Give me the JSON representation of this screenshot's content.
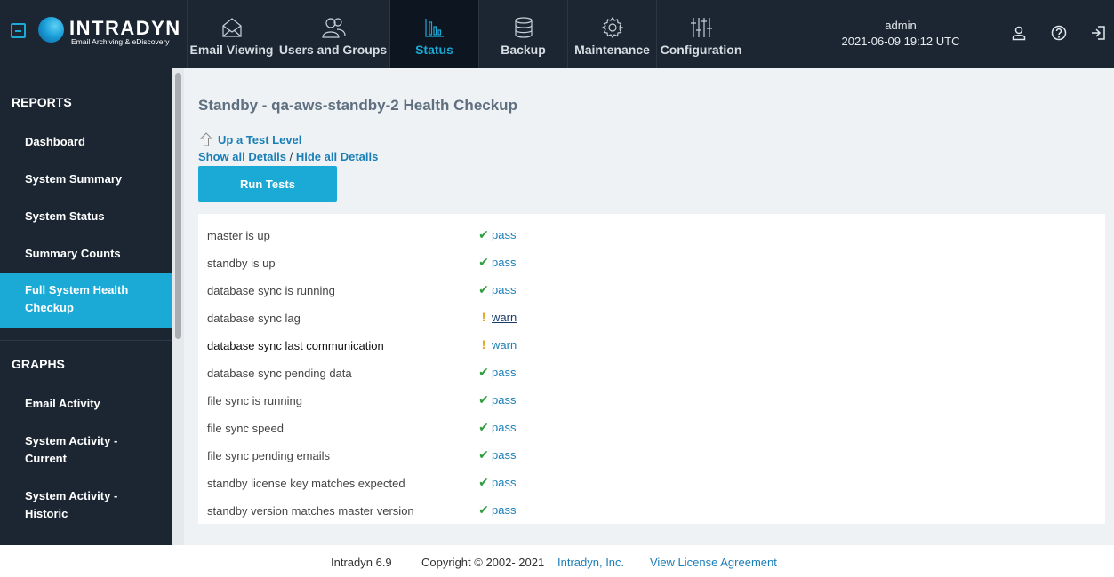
{
  "brand": {
    "name": "INTRADYN",
    "tagline": "Email Archiving & eDiscovery"
  },
  "nav": [
    {
      "label": "Email Viewing",
      "icon": "envelope-icon"
    },
    {
      "label": "Users and Groups",
      "icon": "users-icon"
    },
    {
      "label": "Status",
      "icon": "bar-chart-icon",
      "active": true
    },
    {
      "label": "Backup",
      "icon": "database-icon"
    },
    {
      "label": "Maintenance",
      "icon": "gear-icon"
    },
    {
      "label": "Configuration",
      "icon": "sliders-icon"
    }
  ],
  "user": {
    "name": "admin",
    "datetime": "2021-06-09 19:12 UTC"
  },
  "sidebar": {
    "reports_heading": "REPORTS",
    "reports": [
      {
        "label": "Dashboard"
      },
      {
        "label": "System Summary"
      },
      {
        "label": "System Status"
      },
      {
        "label": "Summary Counts"
      },
      {
        "label": "Full System Health Checkup",
        "active": true
      }
    ],
    "graphs_heading": "GRAPHS",
    "graphs": [
      {
        "label": "Email Activity"
      },
      {
        "label": "System Activity - Current"
      },
      {
        "label": "System Activity - Historic"
      }
    ]
  },
  "main": {
    "title": "Standby - qa-aws-standby-2 Health Checkup",
    "up_link": "Up a Test Level",
    "show_all": "Show all Details",
    "separator": "/",
    "hide_all": "Hide all Details",
    "run_button": "Run Tests",
    "results": [
      {
        "name": "master is up",
        "status": "pass"
      },
      {
        "name": "standby is up",
        "status": "pass"
      },
      {
        "name": "database sync is running",
        "status": "pass"
      },
      {
        "name": "database sync lag",
        "status": "warn"
      },
      {
        "name": "database sync last communication",
        "status": "warn"
      },
      {
        "name": "database sync pending data",
        "status": "pass"
      },
      {
        "name": "file sync is running",
        "status": "pass"
      },
      {
        "name": "file sync speed",
        "status": "pass"
      },
      {
        "name": "file sync pending emails",
        "status": "pass"
      },
      {
        "name": "standby license key matches expected",
        "status": "pass"
      },
      {
        "name": "standby version matches master version",
        "status": "pass"
      }
    ]
  },
  "footer": {
    "version": "Intradyn 6.9",
    "copyright": "Copyright © 2002- 2021",
    "company": "Intradyn, Inc.",
    "license": "View License Agreement"
  },
  "colors": {
    "accent": "#1ba9d6",
    "dark_bg": "#1b2632",
    "pass": "#2e9e3e",
    "warn": "#e7a21a",
    "link": "#1a7fb7"
  }
}
